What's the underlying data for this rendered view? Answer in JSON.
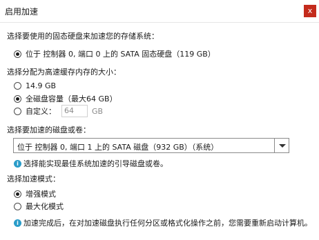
{
  "dialog": {
    "title": "启用加速",
    "close_glyph": "x"
  },
  "target_disk": {
    "label": "选择要使用的固态硬盘来加速您的存储系统：",
    "option": "位于 控制器 0, 端口 0 上的 SATA 固态硬盘（119 GB）"
  },
  "cache_size": {
    "label": "选择分配为高速缓存内存的大小：",
    "options": [
      "14.9 GB",
      "全磁盘容量（最大64 GB）",
      "自定义："
    ],
    "selected_index": 1,
    "custom_value": "64",
    "custom_unit": "GB"
  },
  "accelerated_disk": {
    "label": "选择要加速的磁盘或卷：",
    "selected": "位于 控制器 0, 端口 1 上的 SATA 磁盘（932 GB）（系统）",
    "hint": "选择能实现最佳系统加速的引导磁盘或卷。"
  },
  "mode": {
    "label": "选择加速模式：",
    "options": [
      "增强模式",
      "最大化模式"
    ],
    "selected_index": 0
  },
  "footer_note": "加速完成后，在对加速磁盘执行任何分区或格式化操作之前，您需要重新启动计算机。",
  "icons": {
    "info": "info-icon",
    "close": "close-icon",
    "dropdown": "chevron-down-icon"
  },
  "colors": {
    "close_bg": "#c42b1c",
    "info_icon": "#2a9cc9"
  }
}
